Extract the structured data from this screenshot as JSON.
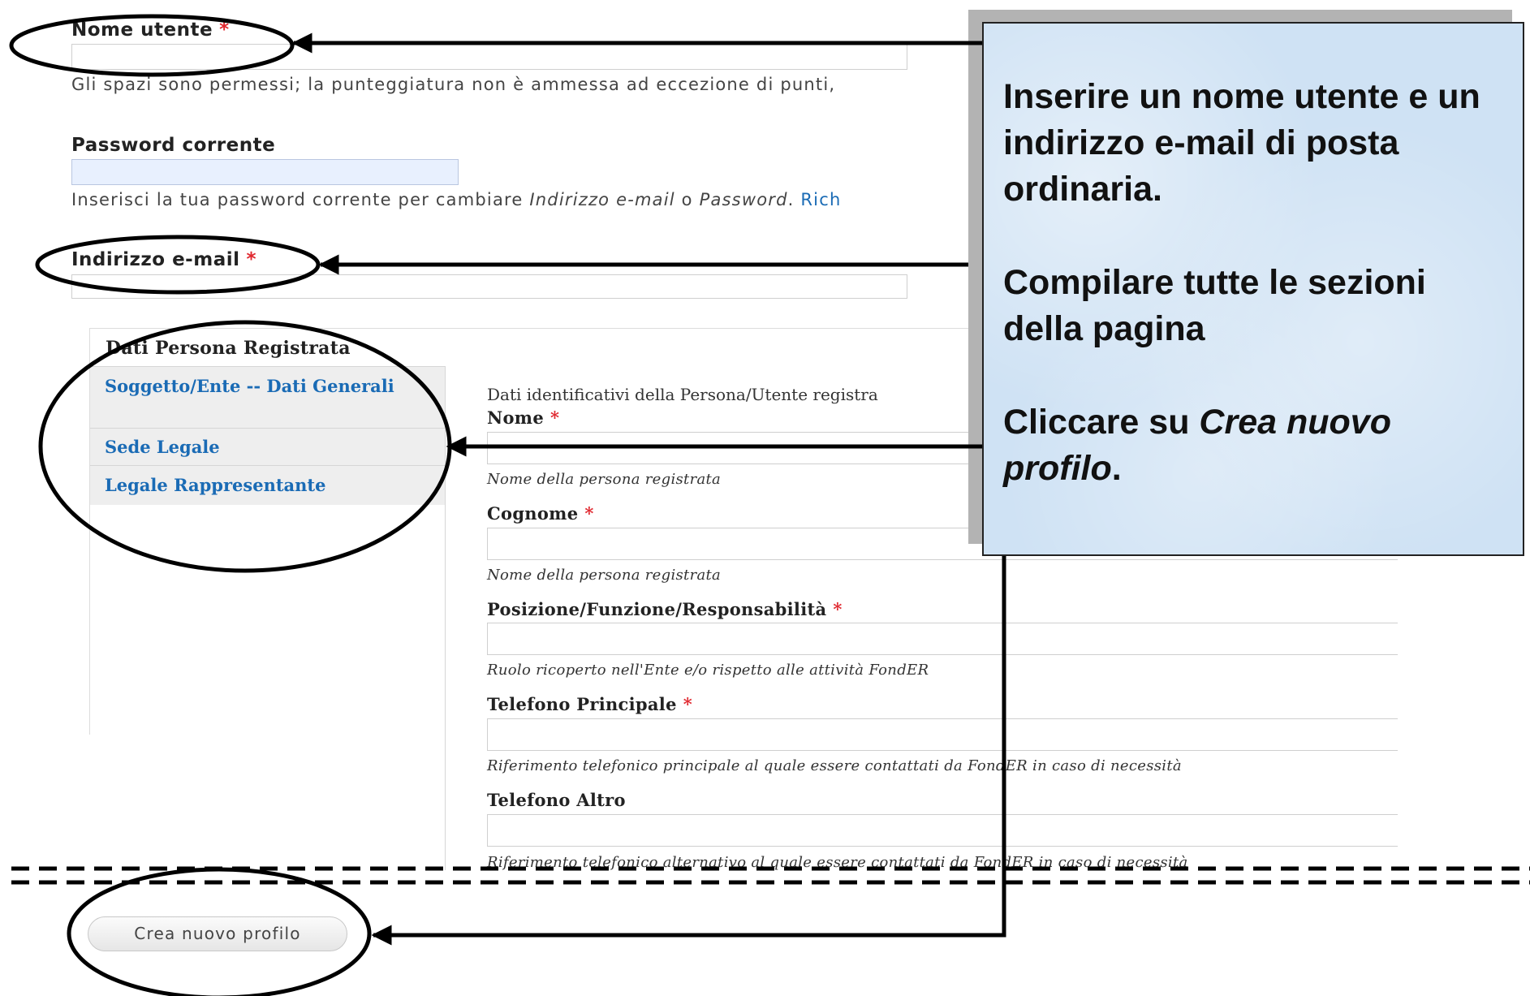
{
  "account": {
    "username_label": "Nome utente",
    "required_mark": "*",
    "username_hint": "Gli spazi sono permessi; la punteggiatura non è ammessa ad eccezione di punti,",
    "password_label": "Password corrente",
    "password_hint_start": "Inserisci la tua password corrente per cambiare ",
    "password_hint_email": "Indirizzo e-mail",
    "password_hint_or": " o ",
    "password_hint_password": "Password",
    "password_hint_dot": ". ",
    "password_hint_link": "Rich",
    "email_label": "Indirizzo e-mail"
  },
  "section": {
    "title": "Dati Persona Registrata",
    "tabs": [
      {
        "label": "Soggetto/Ente -- Dati Generali"
      },
      {
        "label": "Sede Legale"
      },
      {
        "label": "Legale Rappresentante"
      }
    ],
    "intro": "Dati identificativi della Persona/Utente registra",
    "fields": [
      {
        "label": "Nome",
        "required": true,
        "hint": "Nome della persona registrata"
      },
      {
        "label": "Cognome",
        "required": true,
        "hint": "Nome della persona registrata"
      },
      {
        "label": "Posizione/Funzione/Responsabilità",
        "required": true,
        "hint": "Ruolo ricoperto nell'Ente e/o rispetto alle attività FondER"
      },
      {
        "label": "Telefono Principale",
        "required": true,
        "hint": "Riferimento telefonico principale al quale essere contattati da FondER in caso di necessità"
      },
      {
        "label": "Telefono Altro",
        "required": false,
        "hint": "Riferimento telefonico alternativo al quale essere contattati da FondER in caso di necessità"
      }
    ]
  },
  "submit": {
    "label": "Crea nuovo profilo"
  },
  "callout": {
    "p1": "Inserire un nome utente e un indirizzo e-mail di posta ordinaria.",
    "p2": "Compilare tutte le sezioni della pagina",
    "p3_start": "Cliccare su ",
    "p3_em": "Crea nuovo profilo",
    "p3_end": "."
  },
  "colors": {
    "required": "#e0282f",
    "link": "#1a6bb5",
    "callout_bg": "#cfe2f4",
    "input_autofill": "#e8f0fe"
  }
}
